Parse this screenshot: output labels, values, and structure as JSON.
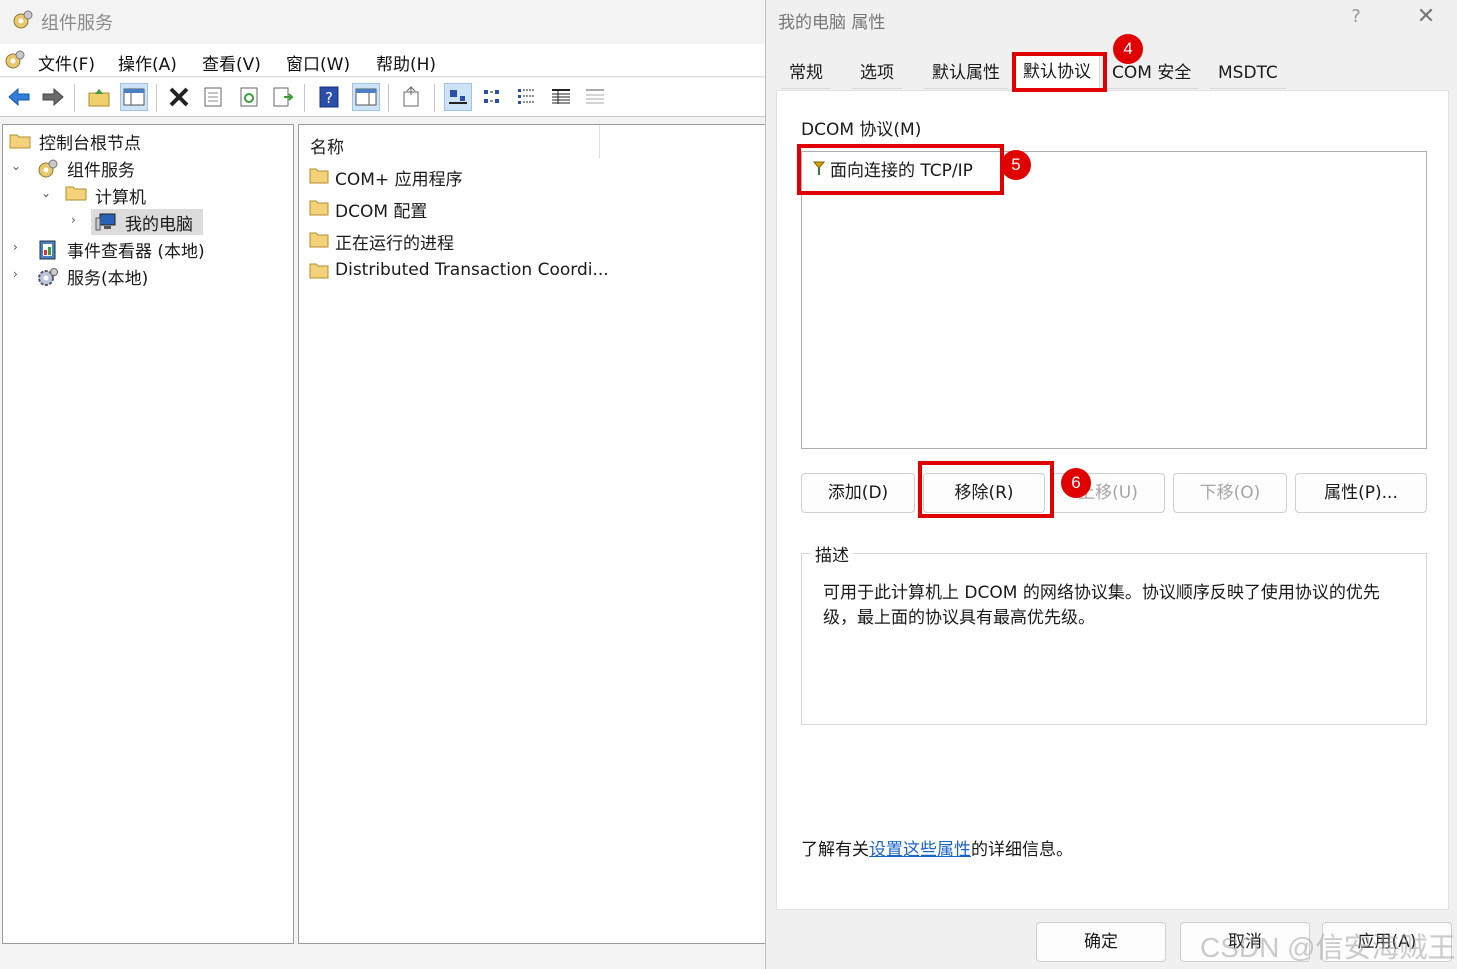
{
  "mmc": {
    "title": "组件服务",
    "menu": [
      "文件(F)",
      "操作(A)",
      "查看(V)",
      "窗口(W)",
      "帮助(H)"
    ],
    "tree": {
      "root": "控制台根节点",
      "component_services": "组件服务",
      "computers": "计算机",
      "my_computer": "我的电脑",
      "event_viewer": "事件查看器 (本地)",
      "services": "服务(本地)"
    },
    "list": {
      "header": "名称",
      "items": [
        "COM+ 应用程序",
        "DCOM 配置",
        "正在运行的进程",
        "Distributed Transaction Coordi..."
      ]
    }
  },
  "dialog": {
    "title": "我的电脑 属性",
    "help": "?",
    "close": "✕",
    "tabs": [
      "常规",
      "选项",
      "默认属性",
      "默认协议",
      "COM 安全",
      "MSDTC"
    ],
    "active_tab": "默认协议",
    "protocol_label": "DCOM 协议(M)",
    "protocol_item": "面向连接的 TCP/IP",
    "buttons": {
      "add": "添加(D)",
      "remove": "移除(R)",
      "move_up": "上移(U)",
      "move_down": "下移(O)",
      "properties": "属性(P)..."
    },
    "desc_legend": "描述",
    "desc_text": "可用于此计算机上 DCOM 的网络协议集。协议顺序反映了使用协议的优先级，最上面的协议具有最高优先级。",
    "info_prefix": "了解有关",
    "info_link": "设置这些属性",
    "info_suffix": "的详细信息。",
    "ok": "确定",
    "cancel": "取消",
    "apply": "应用(A)"
  },
  "annotations": {
    "step4": "4",
    "step5": "5",
    "step6": "6"
  },
  "watermark": "CSDN @信安海贼王",
  "colors": {
    "annotation_red": "#e00000",
    "link_blue": "#1a63c9",
    "selection_bg": "#cfe3f7"
  }
}
